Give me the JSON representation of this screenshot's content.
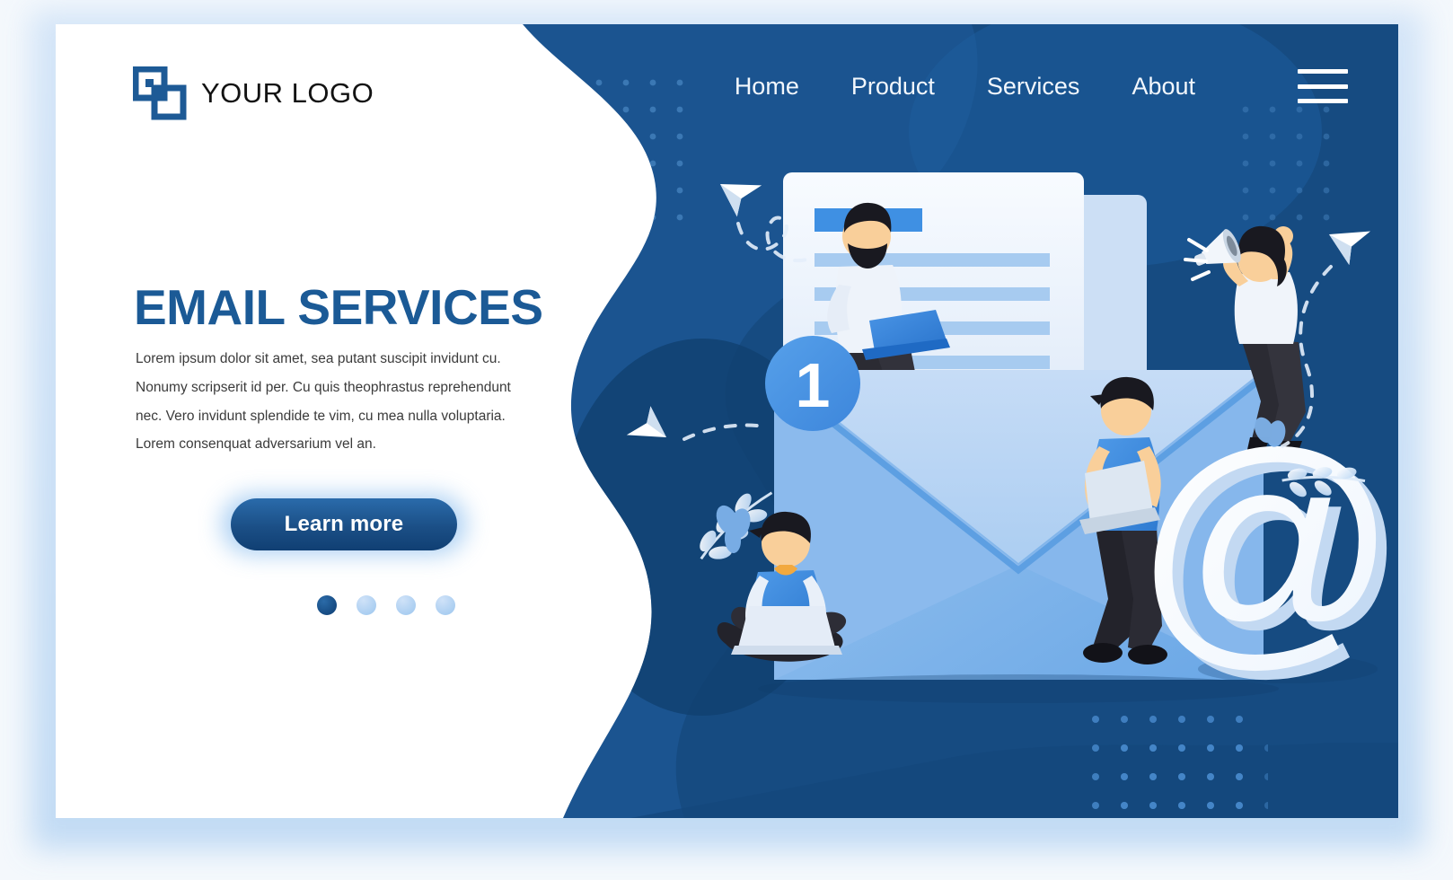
{
  "brand": {
    "logo_icon": "overlapping-squares-logo",
    "name": "YOUR LOGO"
  },
  "nav": {
    "items": [
      {
        "label": "Home"
      },
      {
        "label": "Product"
      },
      {
        "label": "Services"
      },
      {
        "label": "About"
      }
    ],
    "menu_icon": "hamburger-menu-icon"
  },
  "hero": {
    "headline": "EMAIL SERVICES",
    "paragraph": "Lorem ipsum dolor sit amet, sea putant suscipit invidunt cu. Nonumy scripserit id per. Cu quis theophrastus reprehendunt nec. Vero invidunt splendide te vim, cu mea nulla voluptaria. Lorem consenquat adversarium vel an.",
    "cta_label": "Learn more",
    "carousel": {
      "total": 4,
      "active_index": 1
    }
  },
  "illustration": {
    "notification_badge": "1",
    "at_symbol": "@",
    "elements": [
      "envelope",
      "letter-document",
      "paper-plane",
      "megaphone-woman",
      "laptop-man-sitting",
      "laptop-man-standing",
      "cross-legged-laptop-person",
      "leaf-decoration",
      "dot-grid-pattern"
    ]
  },
  "colors": {
    "brand_dark_blue": "#1b5a96",
    "panel_dark": "#1b4f86",
    "panel_darker": "#13406f",
    "accent_blue": "#3d8de0",
    "envelope_light": "#a9cdf2",
    "envelope_mid": "#6aa9e8",
    "white": "#ffffff"
  }
}
